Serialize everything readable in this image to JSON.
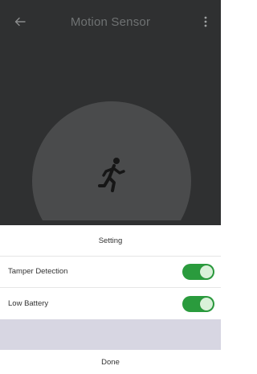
{
  "header": {
    "title": "Motion Sensor",
    "back_icon": "arrow-left-icon",
    "menu_icon": "kebab-menu-icon"
  },
  "hero": {
    "icon": "running-person-icon"
  },
  "sheet": {
    "title": "Setting",
    "items": [
      {
        "label": "Tamper Detection",
        "enabled": true
      },
      {
        "label": "Low Battery",
        "enabled": true
      }
    ],
    "done_label": "Done"
  },
  "colors": {
    "background_dark": "#2f3031",
    "dome": "#4a4b4c",
    "toggle_on": "#2a9b3d",
    "band": "#d7d6e2"
  }
}
